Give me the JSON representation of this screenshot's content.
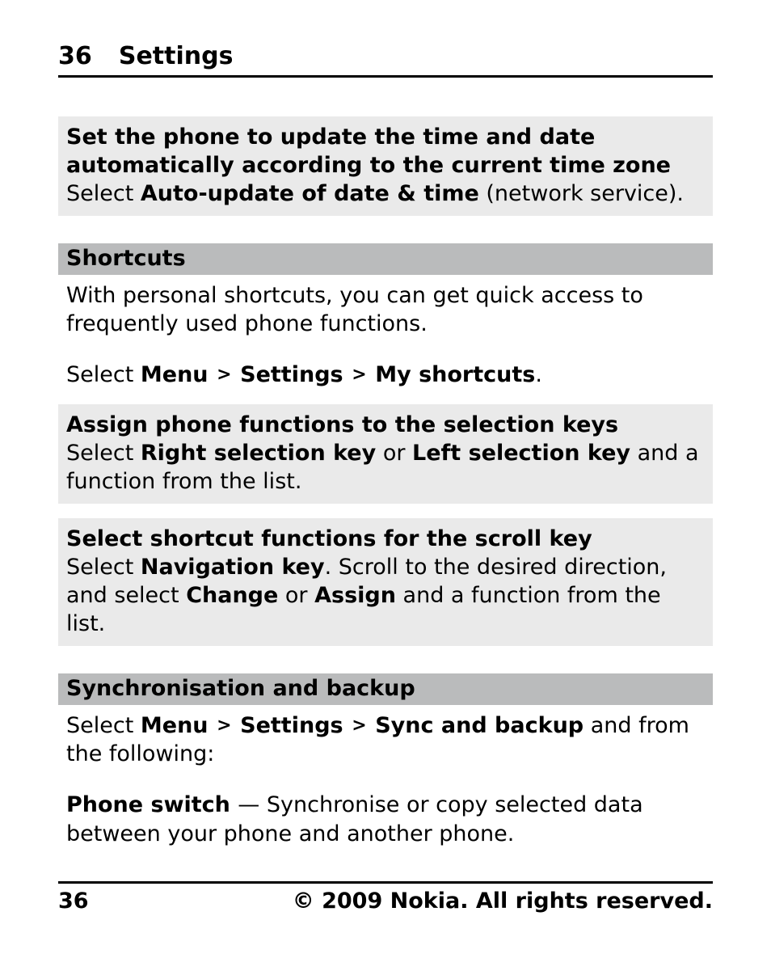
{
  "header": {
    "page_number": "36",
    "section": "Settings"
  },
  "box1": {
    "title": "Set the phone to update the time and date automatically according to the current time zone",
    "body_prefix": "Select ",
    "body_bold": "Auto-update of date & time",
    "body_suffix": " (network service)."
  },
  "section_shortcuts": {
    "title": "Shortcuts",
    "intro": "With personal shortcuts, you can get quick access to frequently used phone functions.",
    "path": {
      "prefix": "Select ",
      "p1": "Menu",
      "p2": "Settings",
      "p3": "My shortcuts",
      "suffix": "."
    }
  },
  "box_assign": {
    "title": "Assign phone functions to the selection keys",
    "t1": "Select ",
    "b1": "Right selection key",
    "t2": " or ",
    "b2": "Left selection key",
    "t3": " and a function from the list."
  },
  "box_scroll": {
    "title": "Select shortcut functions for the scroll key",
    "t1": "Select ",
    "b1": "Navigation key",
    "t2": ". Scroll to the desired direction, and select ",
    "b2": "Change",
    "t3": " or ",
    "b3": "Assign",
    "t4": " and a function from the list."
  },
  "section_sync": {
    "title": "Synchronisation and backup",
    "path": {
      "prefix": "Select ",
      "p1": "Menu",
      "p2": "Settings",
      "p3": "Sync and backup",
      "suffix": " and from the following:"
    },
    "item": {
      "name": "Phone switch ",
      "dash": " — ",
      "desc": "Synchronise or copy selected data between your phone and another phone."
    }
  },
  "footer": {
    "page_number": "36",
    "copyright": "© 2009 Nokia. All rights reserved."
  },
  "symbols": {
    "gt": ">"
  }
}
